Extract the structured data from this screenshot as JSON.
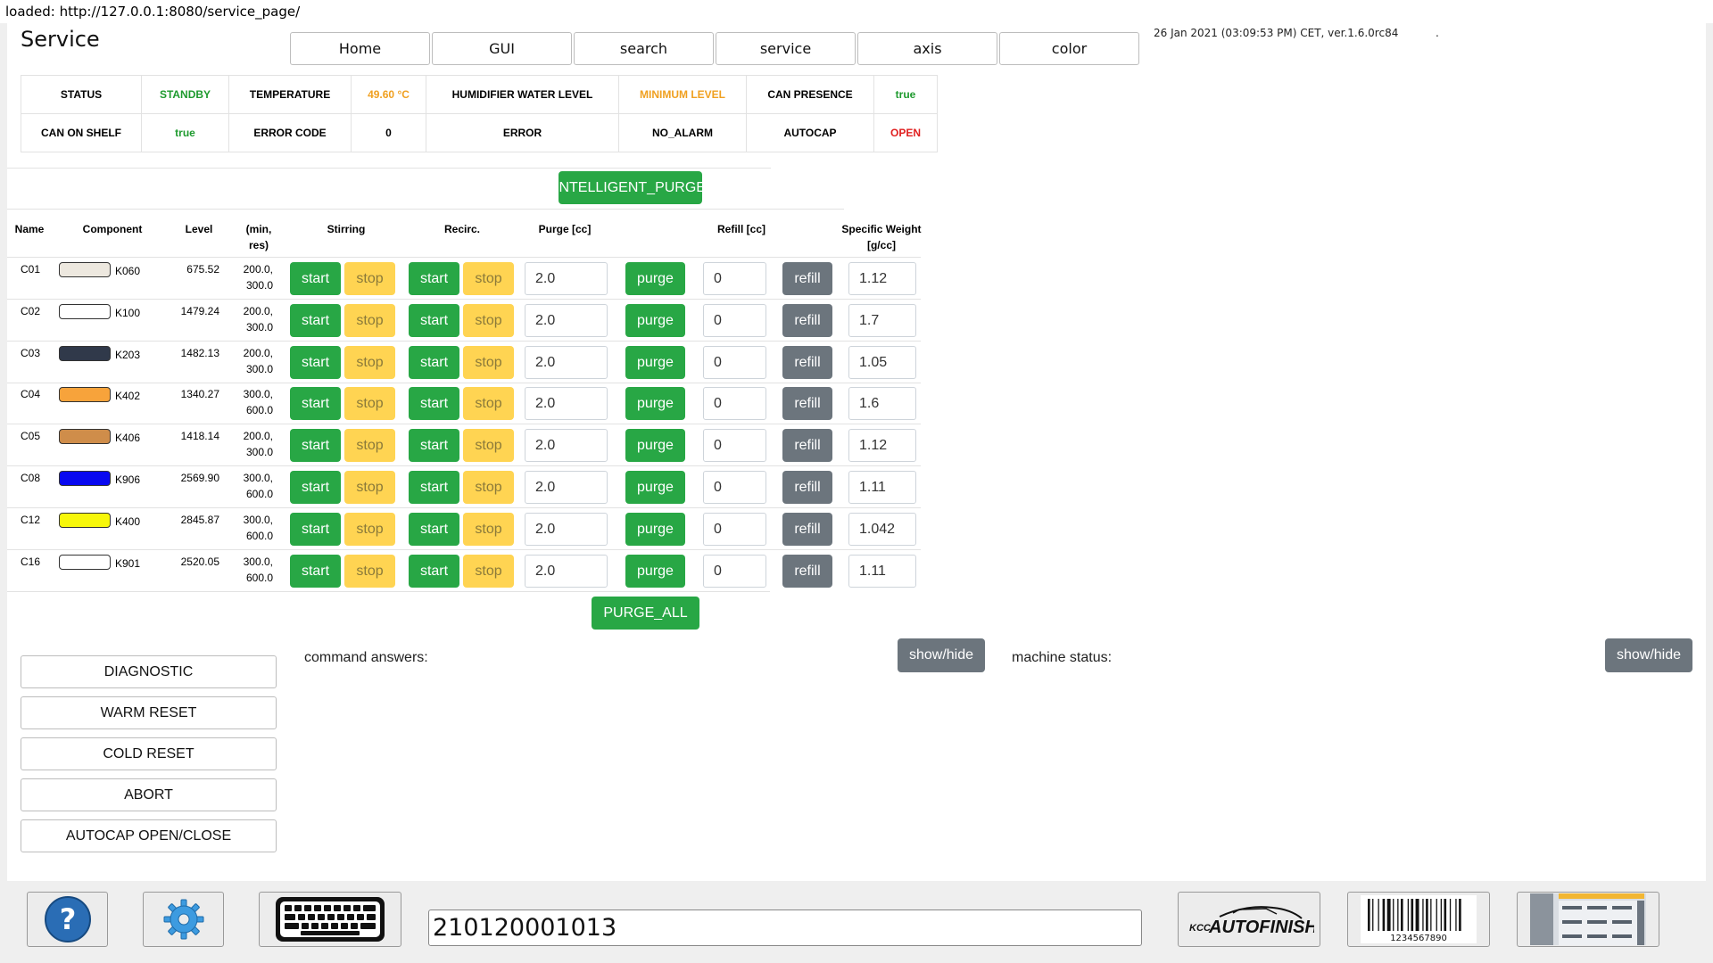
{
  "loaded_bar": "loaded: http://127.0.0.1:8080/service_page/",
  "title": "Service",
  "nav": [
    "Home",
    "GUI",
    "search",
    "service",
    "axis",
    "color"
  ],
  "datetime": "26 Jan 2021 (03:09:53 PM) CET, ver.1.6.0rc84",
  "dot": ".",
  "status": {
    "row1": [
      {
        "label": "STATUS",
        "value": "STANDBY",
        "color": "green"
      },
      {
        "label": "TEMPERATURE",
        "value": "49.60 °C",
        "color": "orange"
      },
      {
        "label": "HUMIDIFIER WATER LEVEL",
        "value": "MINIMUM LEVEL",
        "color": "orange"
      },
      {
        "label": "CAN PRESENCE",
        "value": "true",
        "color": "green"
      }
    ],
    "row2": [
      {
        "label": "CAN ON SHELF",
        "value": "true",
        "color": "green"
      },
      {
        "label": "ERROR CODE",
        "value": "0",
        "color": "black"
      },
      {
        "label": "ERROR",
        "value": "NO_ALARM",
        "color": "black"
      },
      {
        "label": "AUTOCAP",
        "value": "OPEN",
        "color": "red"
      }
    ]
  },
  "intelligent_purge": "INTELLIGENT_PURGE",
  "headers": {
    "name": "Name",
    "component": "Component",
    "level": "Level",
    "minres": "(min, res)",
    "stirring": "Stirring",
    "recirc": "Recirc.",
    "purge": "Purge [cc]",
    "refill": "Refill [cc]",
    "specific_weight": "Specific Weight [g/cc]"
  },
  "button_labels": {
    "start": "start",
    "stop": "stop",
    "purge": "purge",
    "refill": "refill"
  },
  "rows": [
    {
      "name": "C01",
      "color": "#ede8df",
      "component": "K060",
      "level": "675.52",
      "min": "200.0,",
      "res": "300.0",
      "purge": "2.0",
      "refill": "0",
      "sw": "1.12"
    },
    {
      "name": "C02",
      "color": "#ffffff",
      "component": "K100",
      "level": "1479.24",
      "min": "200.0,",
      "res": "300.0",
      "purge": "2.0",
      "refill": "0",
      "sw": "1.7"
    },
    {
      "name": "C03",
      "color": "#30394a",
      "component": "K203",
      "level": "1482.13",
      "min": "200.0,",
      "res": "300.0",
      "purge": "2.0",
      "refill": "0",
      "sw": "1.05"
    },
    {
      "name": "C04",
      "color": "#f7a33b",
      "component": "K402",
      "level": "1340.27",
      "min": "300.0,",
      "res": "600.0",
      "purge": "2.0",
      "refill": "0",
      "sw": "1.6"
    },
    {
      "name": "C05",
      "color": "#cf8d4a",
      "component": "K406",
      "level": "1418.14",
      "min": "200.0,",
      "res": "300.0",
      "purge": "2.0",
      "refill": "0",
      "sw": "1.12"
    },
    {
      "name": "C08",
      "color": "#0808f0",
      "component": "K906",
      "level": "2569.90",
      "min": "300.0,",
      "res": "600.0",
      "purge": "2.0",
      "refill": "0",
      "sw": "1.11"
    },
    {
      "name": "C12",
      "color": "#f7f70a",
      "component": "K400",
      "level": "2845.87",
      "min": "300.0,",
      "res": "600.0",
      "purge": "2.0",
      "refill": "0",
      "sw": "1.042"
    },
    {
      "name": "C16",
      "color": "#ffffff",
      "component": "K901",
      "level": "2520.05",
      "min": "300.0,",
      "res": "600.0",
      "purge": "2.0",
      "refill": "0",
      "sw": "1.11"
    }
  ],
  "purge_all": "PURGE_ALL",
  "side_buttons": [
    "DIAGNOSTIC",
    "WARM RESET",
    "COLD RESET",
    "ABORT",
    "AUTOCAP OPEN/CLOSE"
  ],
  "command_answers": "command answers:",
  "machine_status": "machine status:",
  "show_hide": "show/hide",
  "footer": {
    "input_value": "210120001013",
    "brand_prefix": "KCC",
    "brand_name": "AUTOFINISH",
    "barcode_number": "1234567890"
  }
}
